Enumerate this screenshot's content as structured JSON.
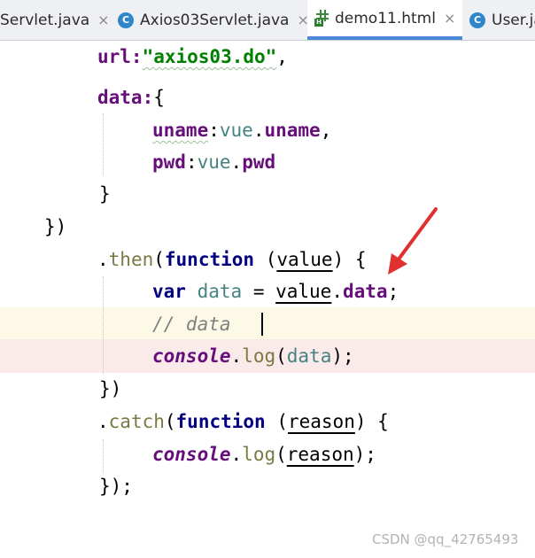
{
  "tabs": [
    {
      "label": "Servlet.java",
      "icon": "none",
      "close": "×"
    },
    {
      "label": "Axios03Servlet.java",
      "icon": "class-c-icon",
      "close": "×",
      "icon_text": "C"
    },
    {
      "label": "demo11.html",
      "icon": "html-file-icon",
      "close": "×",
      "active": true,
      "icon_text": "H"
    },
    {
      "label": "User.ja",
      "icon": "class-c-icon",
      "icon_text": "C"
    }
  ],
  "code": {
    "l1": {
      "a": "url:",
      "b": "\"axios03.do\"",
      "c": ","
    },
    "l2": {
      "a": "data:",
      "b": "{"
    },
    "l3": {
      "a": "uname",
      "b": ":",
      "c": "vue",
      "d": ".",
      "e": "uname",
      "f": ","
    },
    "l4": {
      "a": "pwd",
      "b": ":",
      "c": "vue",
      "d": ".",
      "e": "pwd"
    },
    "l5": {
      "a": "}"
    },
    "l6": {
      "a": "})"
    },
    "l7": {
      "a": ".",
      "b": "then",
      "c": "(",
      "d": "function",
      "e": " (",
      "f": "value",
      "g": ") {"
    },
    "l8": {
      "a": "var",
      "b": " ",
      "c": "data",
      "d": " = ",
      "e": "value",
      "f": ".",
      "g": "data",
      "h": ";"
    },
    "l9": {
      "a": "// data "
    },
    "l10": {
      "a": "console",
      "b": ".",
      "c": "log",
      "d": "(",
      "e": "data",
      "f": ");"
    },
    "l11": {
      "a": "})"
    },
    "l12": {
      "a": ".",
      "b": "catch",
      "c": "(",
      "d": "function",
      "e": " (",
      "f": "reason",
      "g": ") {"
    },
    "l13": {
      "a": "console",
      "b": ".",
      "c": "log",
      "d": "(",
      "e": "reason",
      "f": ");"
    },
    "l14": {
      "a": "});"
    }
  },
  "watermark": "CSDN @qq_42765493",
  "colors": {
    "active_tab_underline": "#4a88d8",
    "arrow": "#e03030",
    "breakpoint_line": "#fbeaea",
    "current_line": "#fcfae6"
  }
}
